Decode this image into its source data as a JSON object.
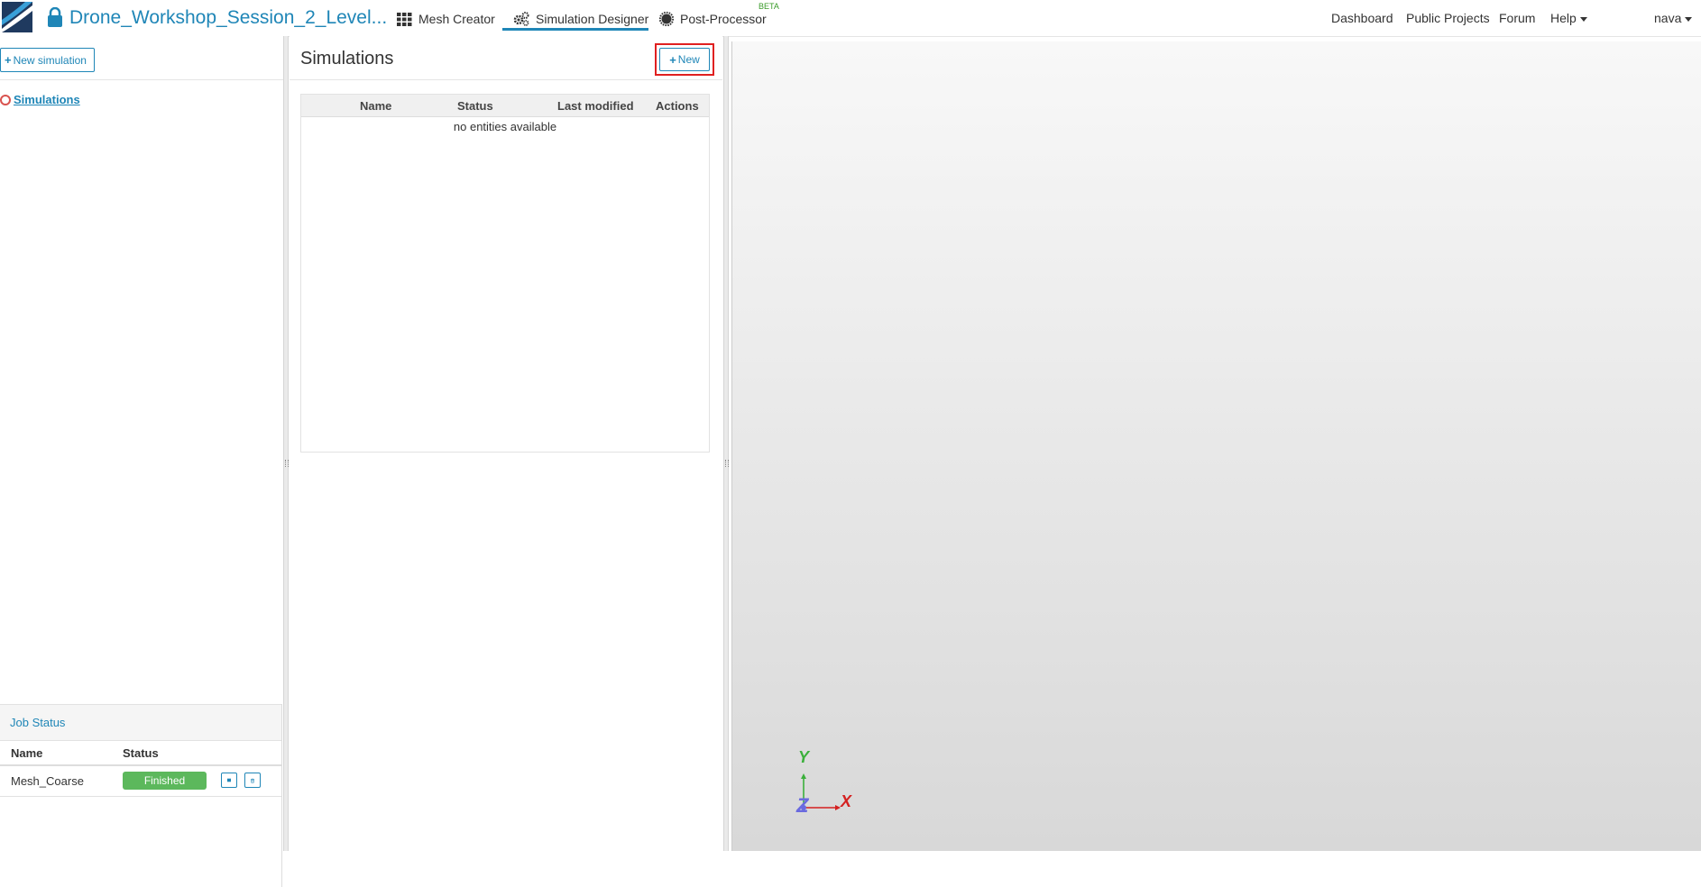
{
  "topnav": {
    "project_title": "Drone_Workshop_Session_2_Level...",
    "tabs": [
      {
        "label": "Mesh Creator",
        "icon": "grid-icon"
      },
      {
        "label": "Simulation Designer",
        "icon": "gears-icon"
      },
      {
        "label": "Post-Processor",
        "icon": "gear-icon"
      }
    ],
    "beta_badge": "BETA",
    "right_links": [
      "Dashboard",
      "Public Projects",
      "Forum",
      "Help"
    ],
    "user": "nava"
  },
  "left": {
    "new_sim_label": "New simulation",
    "tree_item": "Simulations"
  },
  "job_status": {
    "title": "Job Status",
    "columns": [
      "Name",
      "Status"
    ],
    "rows": [
      {
        "name": "Mesh_Coarse",
        "status": "Finished"
      }
    ]
  },
  "simulations": {
    "title": "Simulations",
    "new_label": "New",
    "columns": [
      "Name",
      "Status",
      "Last modified",
      "Actions"
    ],
    "empty_text": "no entities available"
  },
  "viewport": {
    "axis_labels": {
      "x": "X",
      "y": "Y",
      "z": "Z"
    }
  },
  "colors": {
    "accent": "#1f86b7",
    "success": "#5cb85c",
    "highlight": "#e02020"
  }
}
